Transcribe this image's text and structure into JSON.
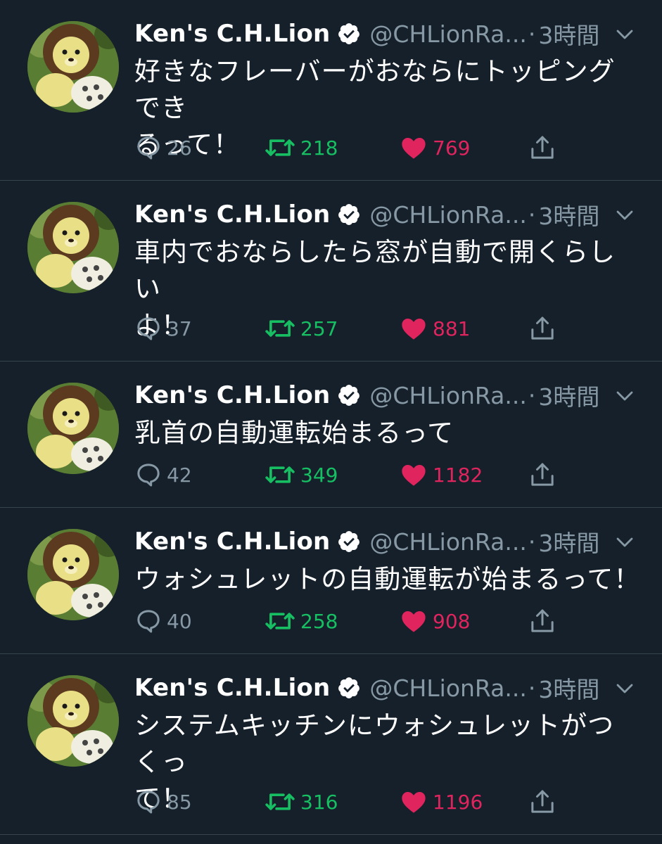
{
  "colors": {
    "background": "#15202b",
    "divider": "#38444d",
    "secondary_text": "#8899a6",
    "retweet_green": "#17bf63",
    "like_red": "#e0245e",
    "verified_fill": "#ffffff"
  },
  "icons": {
    "reply": "speech-bubble-icon",
    "retweet": "retweet-arrows-icon",
    "like": "heart-icon",
    "share": "share-upload-icon",
    "menu": "chevron-down-icon",
    "verified": "verified-badge-icon"
  },
  "tweets": [
    {
      "name": "Ken's C.H.Lion",
      "handle": "@CHLionRa...",
      "dot": "·",
      "time": "3時間",
      "lines": [
        "好きなフレーバーがおならにトッピングでき",
        "るって！"
      ],
      "replies": "26",
      "retweets": "218",
      "likes": "769"
    },
    {
      "name": "Ken's C.H.Lion",
      "handle": "@CHLionRa...",
      "dot": "·",
      "time": "3時間",
      "lines": [
        "車内でおならしたら窓が自動で開くらしい",
        "よ！"
      ],
      "replies": "37",
      "retweets": "257",
      "likes": "881"
    },
    {
      "name": "Ken's C.H.Lion",
      "handle": "@CHLionRa...",
      "dot": "·",
      "time": "3時間",
      "lines": [
        "乳首の自動運転始まるって"
      ],
      "replies": "42",
      "retweets": "349",
      "likes": "1182"
    },
    {
      "name": "Ken's C.H.Lion",
      "handle": "@CHLionRa...",
      "dot": "·",
      "time": "3時間",
      "lines": [
        "ウォシュレットの自動運転が始まるって！"
      ],
      "replies": "40",
      "retweets": "258",
      "likes": "908"
    },
    {
      "name": "Ken's C.H.Lion",
      "handle": "@CHLionRa...",
      "dot": "·",
      "time": "3時間",
      "lines": [
        "システムキッチンにウォシュレットがつくっ",
        "て！"
      ],
      "replies": "85",
      "retweets": "316",
      "likes": "1196"
    }
  ]
}
